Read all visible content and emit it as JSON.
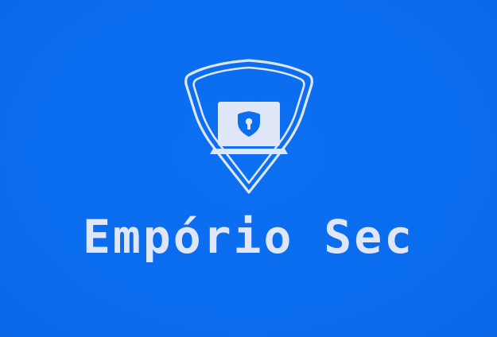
{
  "logo": {
    "brand_name": "Empório Sec",
    "emblem_icon": "shield-laptop-lock-icon",
    "colors": {
      "background": "#0a6ef0",
      "foreground": "#dfe6f7",
      "screen_fill": "#dfe6f7",
      "lock_fill": "#0a6ef0"
    }
  }
}
